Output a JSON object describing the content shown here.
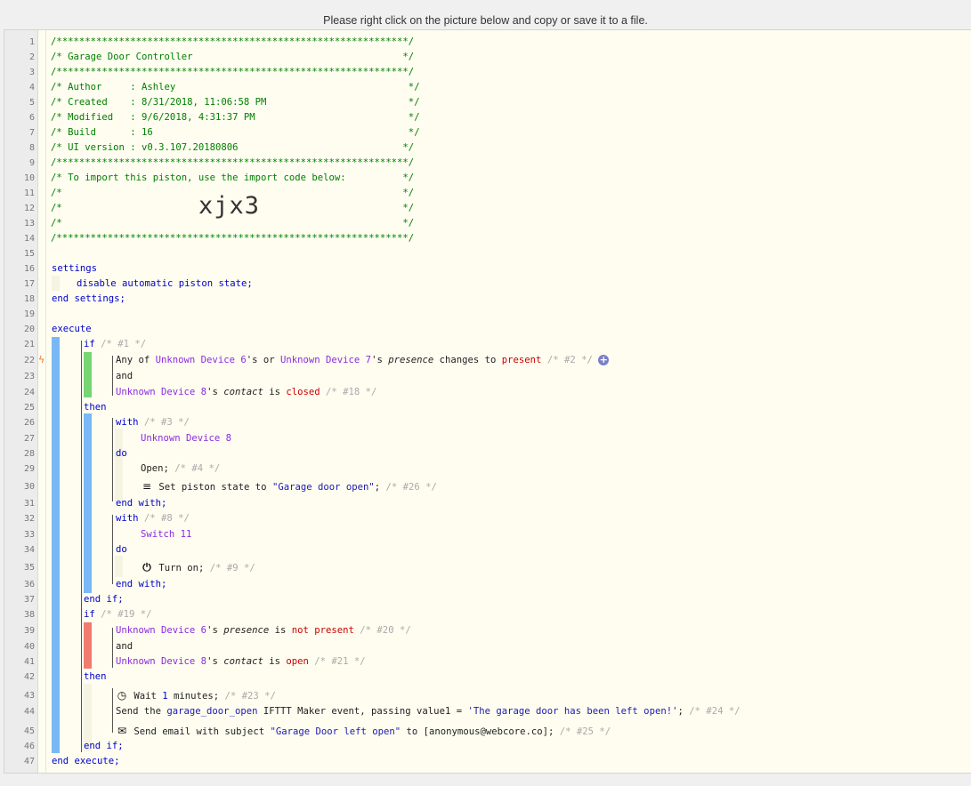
{
  "banner": "Please right click on the picture below and copy or save it to a file.",
  "header": {
    "border": "/**************************************************************/",
    "title": "/* Garage Door Controller                                     */",
    "author": "/* Author     : Ashley                                         */",
    "created": "/* Created    : 8/31/2018, 11:06:58 PM                         */",
    "modified": "/* Modified   : 9/6/2018, 4:31:37 PM                           */",
    "build": "/* Build      : 16                                             */",
    "ui_version": "/* UI version : v0.3.107.20180806                             */",
    "import_note": "/* To import this piston, use the import code below:          */",
    "blank": "/*                                                            */",
    "import_code": "xjx3"
  },
  "line_numbers": [
    "1",
    "2",
    "3",
    "4",
    "5",
    "6",
    "7",
    "8",
    "9",
    "10",
    "11",
    "12",
    "13",
    "14",
    "15",
    "16",
    "17",
    "18",
    "19",
    "20",
    "21",
    "22",
    "23",
    "24",
    "25",
    "26",
    "27",
    "28",
    "29",
    "30",
    "31",
    "32",
    "33",
    "34",
    "35",
    "36",
    "37",
    "38",
    "39",
    "40",
    "41",
    "42",
    "43",
    "44",
    "45",
    "46",
    "47"
  ],
  "code": {
    "settings": "settings",
    "disable": "disable automatic piston state;",
    "end_settings": "end settings;",
    "execute": "execute",
    "if1": "if",
    "if1_c": "/* #1 */",
    "any_of": "Any of ",
    "dev6": "Unknown Device 6",
    "s_or": "'s or ",
    "dev7": "Unknown Device 7",
    "s": "'s ",
    "presence": "presence",
    "changes_to": " changes to ",
    "present": "present",
    "c2": " /* #2 */ ",
    "plus": "+",
    "and": "and",
    "dev8": "Unknown Device 8",
    "contact": "contact",
    "is": " is ",
    "closed": "closed",
    "c18": " /* #18 */",
    "then": "then",
    "with": "with",
    "c3": " /* #3 */",
    "do": "do",
    "open_cmd": "Open;",
    "c4": " /* #4 */",
    "set_state": " Set piston state to ",
    "state_str": "\"Garage door open\"",
    "semi": ";",
    "c26": " /* #26 */",
    "end_with": "end with;",
    "c8": " /* #8 */",
    "switch11": "Switch 11",
    "turn_on": " Turn on;",
    "c9": " /* #9 */",
    "end_if": "end if;",
    "if2": "if",
    "c19": " /* #19 */",
    "is_not": " is ",
    "not": "not",
    "present2": " present",
    "c20": " /* #20 */",
    "open_val": "open",
    "c21": " /* #21 */",
    "wait": " Wait ",
    "wait_num": "1",
    "minutes": " minutes;",
    "c23": " /* #23 */",
    "send_the": "Send the ",
    "event_name": "garage_door_open",
    "ifttt": " IFTTT Maker event, passing value1 = ",
    "value1": "'The garage door has been left open!'",
    "c24": " /* #24 */",
    "send_email": " Send email with subject ",
    "subject": "\"Garage Door left open\"",
    "to": " to [anonymous@webcore.co];",
    "c25": " /* #25 */",
    "end_execute": "end execute;"
  },
  "icons": {
    "lightning": "lightning-icon",
    "list": "list-icon",
    "power": "power-icon",
    "clock": "clock-icon",
    "envelope": "envelope-icon"
  },
  "colors": {
    "background": "#fefdf0",
    "comment": "#008000",
    "keyword": "#0000cc",
    "device": "#8a2be2",
    "string": "#1a1ab3",
    "value_red": "#cc0000",
    "bar_blue": "#7ab8f5",
    "bar_green": "#77d672",
    "bar_red": "#f07b6e"
  }
}
